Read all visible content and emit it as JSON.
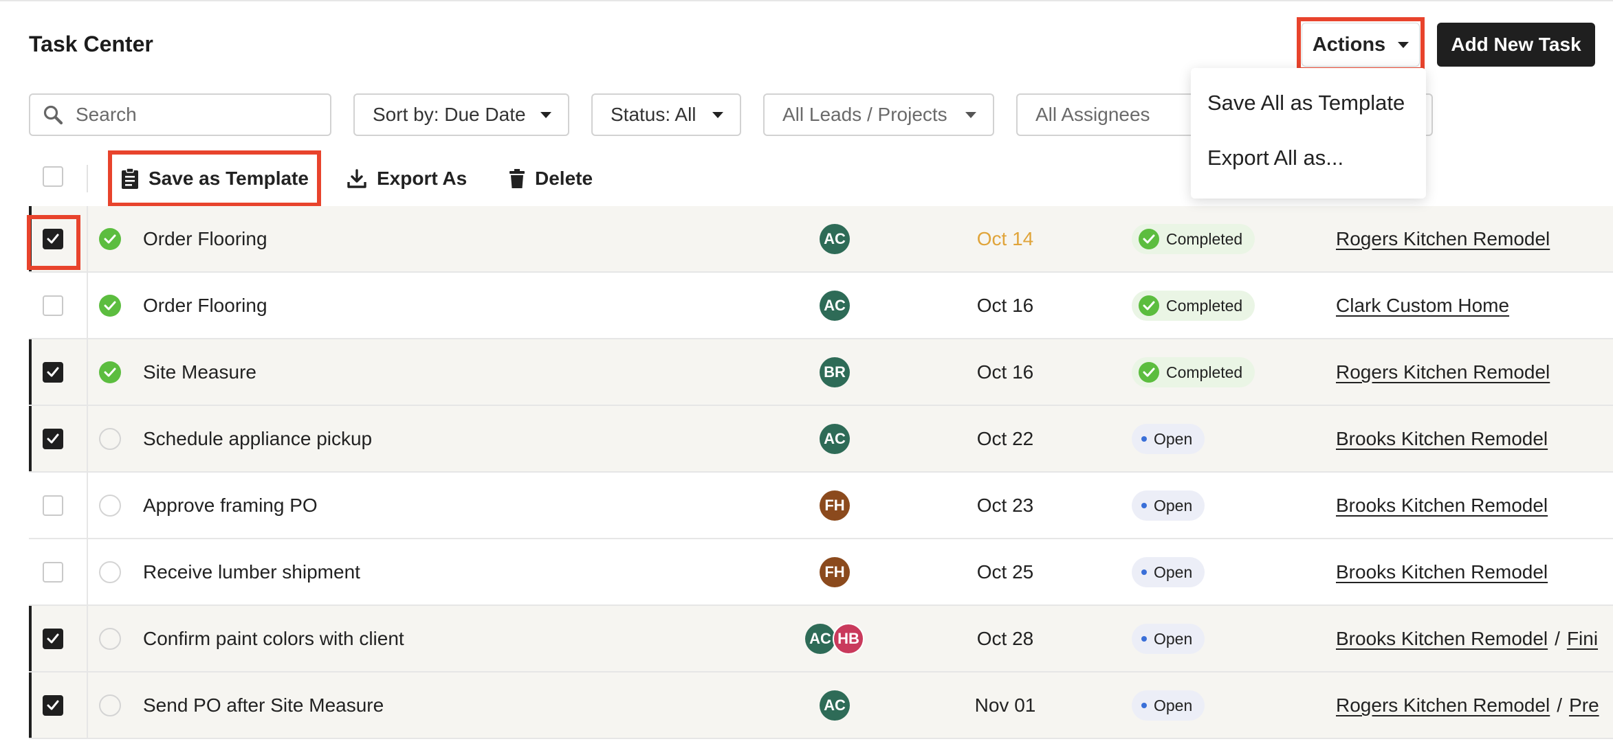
{
  "header": {
    "title": "Task Center",
    "actions_label": "Actions",
    "add_task_label": "Add New Task"
  },
  "filters": {
    "search_placeholder": "Search",
    "sort_label": "Sort by: Due Date",
    "status_label": "Status: All",
    "leads_label": "All Leads / Projects",
    "assignees_label": "All Assignees"
  },
  "bulk": {
    "save_template_label": "Save as Template",
    "export_label": "Export As",
    "delete_label": "Delete"
  },
  "actions_menu": {
    "items": [
      "Save All as Template",
      "Export All as..."
    ]
  },
  "colors": {
    "completed_green": "#5cbd3f",
    "overdue_amber": "#e0a43a",
    "highlight_red": "#e8432c",
    "avatar_ac": "#2e6b57",
    "avatar_br": "#2e6b57",
    "avatar_fh": "#8b4a1d",
    "avatar_hb": "#c93a5c"
  },
  "rows": [
    {
      "checked": true,
      "done": true,
      "task": "Order Flooring",
      "assignees": [
        "AC"
      ],
      "due": "Oct 14",
      "overdue": true,
      "status": "Completed",
      "projects": [
        "Rogers Kitchen Remodel"
      ]
    },
    {
      "checked": false,
      "done": true,
      "task": "Order Flooring",
      "assignees": [
        "AC"
      ],
      "due": "Oct 16",
      "overdue": false,
      "status": "Completed",
      "projects": [
        "Clark Custom Home"
      ]
    },
    {
      "checked": true,
      "done": true,
      "task": "Site Measure",
      "assignees": [
        "BR"
      ],
      "due": "Oct 16",
      "overdue": false,
      "status": "Completed",
      "projects": [
        "Rogers Kitchen Remodel"
      ]
    },
    {
      "checked": true,
      "done": false,
      "task": "Schedule appliance pickup",
      "assignees": [
        "AC"
      ],
      "due": "Oct 22",
      "overdue": false,
      "status": "Open",
      "projects": [
        "Brooks Kitchen Remodel"
      ]
    },
    {
      "checked": false,
      "done": false,
      "task": "Approve framing PO",
      "assignees": [
        "FH"
      ],
      "due": "Oct 23",
      "overdue": false,
      "status": "Open",
      "projects": [
        "Brooks Kitchen Remodel"
      ]
    },
    {
      "checked": false,
      "done": false,
      "task": "Receive lumber shipment",
      "assignees": [
        "FH"
      ],
      "due": "Oct 25",
      "overdue": false,
      "status": "Open",
      "projects": [
        "Brooks Kitchen Remodel"
      ]
    },
    {
      "checked": true,
      "done": false,
      "task": "Confirm paint colors with client",
      "assignees": [
        "AC",
        "HB"
      ],
      "due": "Oct 28",
      "overdue": false,
      "status": "Open",
      "projects": [
        "Brooks Kitchen Remodel",
        "Fini"
      ]
    },
    {
      "checked": true,
      "done": false,
      "task": "Send PO after Site Measure",
      "assignees": [
        "AC"
      ],
      "due": "Nov 01",
      "overdue": false,
      "status": "Open",
      "projects": [
        "Rogers Kitchen Remodel",
        "Pre"
      ]
    }
  ]
}
